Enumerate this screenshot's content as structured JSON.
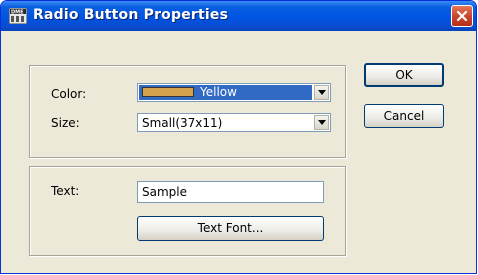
{
  "window": {
    "title": "Radio Button Properties"
  },
  "icons": {
    "app": "dme-app-icon",
    "close": "close-icon",
    "dropdown": "chevron-down-icon"
  },
  "colors": {
    "titlebar": "#0054e3",
    "close_button": "#c8412a",
    "selection": "#316ac5",
    "color_swatch": "#d2a24c",
    "dialog_bg": "#ece9d8"
  },
  "appearance_group": {
    "color": {
      "label": "Color:",
      "value": "Yellow"
    },
    "size": {
      "label": "Size:",
      "value": "Small(37x11)"
    }
  },
  "text_group": {
    "text": {
      "label": "Text:",
      "value": "Sample"
    },
    "text_font_button": "Text Font..."
  },
  "buttons": {
    "ok": "OK",
    "cancel": "Cancel"
  }
}
